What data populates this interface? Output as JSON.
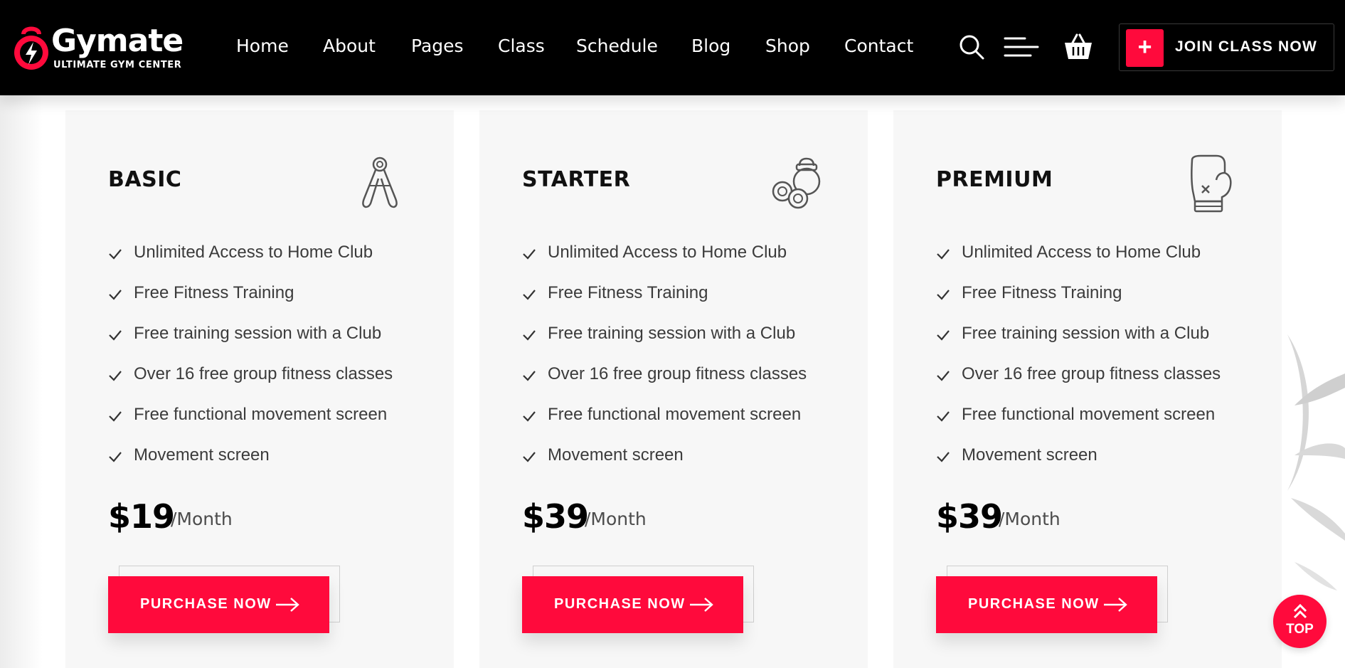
{
  "header": {
    "logo": {
      "name": "Gymate",
      "tagline": "ULTIMATE GYM CENTER",
      "icon": "kettlebell-bolt-icon"
    },
    "nav": [
      "Home",
      "About",
      "Pages",
      "Class",
      "Schedule",
      "Blog",
      "Shop",
      "Contact"
    ],
    "icons": [
      "search-icon",
      "menu-icon",
      "basket-icon"
    ],
    "cta": {
      "plus": "+",
      "label": "JOIN CLASS NOW"
    }
  },
  "plans": [
    {
      "title": "BASIC",
      "icon": "hand-gripper-icon",
      "features": [
        "Unlimited Access to Home Club",
        "Free Fitness Training",
        "Free training session with a Club",
        "Over 16 free group fitness classes",
        "Free functional movement screen",
        "Movement screen"
      ],
      "price": "$19",
      "period": "/Month",
      "button": "PURCHASE NOW"
    },
    {
      "title": "STARTER",
      "icon": "kettlebell-dumbbell-icon",
      "features": [
        "Unlimited Access to Home Club",
        "Free Fitness Training",
        "Free training session with a Club",
        "Over 16 free group fitness classes",
        "Free functional movement screen",
        "Movement screen"
      ],
      "price": "$39",
      "period": "/Month",
      "button": "PURCHASE NOW"
    },
    {
      "title": "PREMIUM",
      "icon": "boxing-glove-icon",
      "features": [
        "Unlimited Access to Home Club",
        "Free Fitness Training",
        "Free training session with a Club",
        "Over 16 free group fitness classes",
        "Free functional movement screen",
        "Movement screen"
      ],
      "price": "$39",
      "period": "/Month",
      "button": "PURCHASE NOW"
    }
  ],
  "back_to_top": {
    "label": "TOP",
    "icon": "double-chevron-up-icon"
  },
  "colors": {
    "accent": "#ff0a3c",
    "header_bg": "#000000",
    "card_bg": "#f7f7f7",
    "text": "#3b3b3b"
  }
}
